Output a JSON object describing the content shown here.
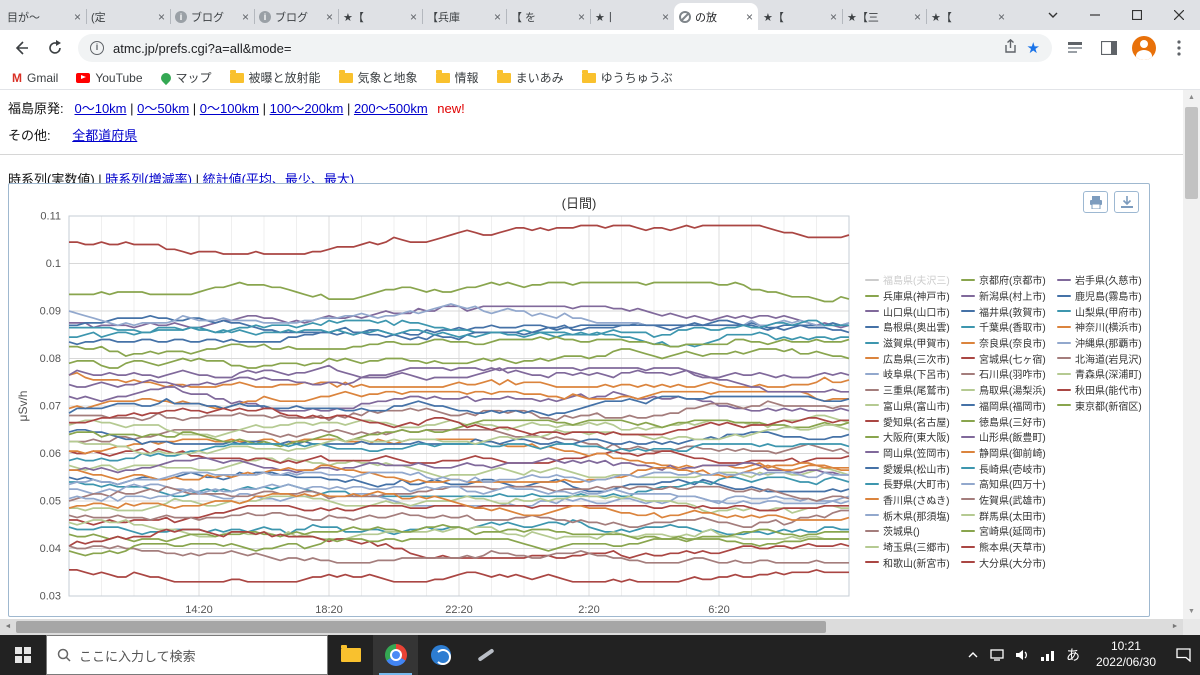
{
  "window": {
    "tabs": [
      {
        "title": "目が〜",
        "icon": "page"
      },
      {
        "title": "(定",
        "icon": "page"
      },
      {
        "title": "ブログ",
        "icon": "info"
      },
      {
        "title": "ブログ",
        "icon": "info"
      },
      {
        "title": "★【",
        "icon": "page"
      },
      {
        "title": "【兵庫",
        "icon": "page"
      },
      {
        "title": "【 を",
        "icon": "page"
      },
      {
        "title": "★丨",
        "icon": "page"
      },
      {
        "title": "の放",
        "icon": "blocked"
      },
      {
        "title": "★【",
        "icon": "page"
      },
      {
        "title": "★【三",
        "icon": "page"
      },
      {
        "title": "★【",
        "icon": "page"
      }
    ],
    "active_tab_index": 8,
    "close_glyph": "×"
  },
  "nav": {
    "url": "atmc.jp/prefs.cgi?a=all&mode="
  },
  "bookmarks": [
    {
      "label": "Gmail",
      "icon": "gmail"
    },
    {
      "label": "YouTube",
      "icon": "youtube"
    },
    {
      "label": "マップ",
      "icon": "maps"
    },
    {
      "label": "被曝と放射能",
      "icon": "folder"
    },
    {
      "label": "気象と地象",
      "icon": "folder"
    },
    {
      "label": "情報",
      "icon": "folder"
    },
    {
      "label": "まいあみ",
      "icon": "folder"
    },
    {
      "label": "ゆうちゅうぶ",
      "icon": "folder"
    }
  ],
  "page": {
    "row1_label": "福島原発:",
    "row1_links": [
      "0〜10km",
      "0〜50km",
      "0〜100km",
      "100〜200km",
      "200〜500km"
    ],
    "row1_new": "new!",
    "row2_label": "その他:",
    "row2_link": "全都道府県",
    "view_links": [
      "時系列(実数値)",
      "時系列(増減率)",
      "統計値(平均、最少、最大)"
    ],
    "view_current_index": 0
  },
  "colors": {
    "link": "#0000cc",
    "new_badge": "#e00000",
    "hidden_series": "#cccccc"
  },
  "chart_data": {
    "type": "line",
    "title": "(日間)",
    "ylabel": "μSv/h",
    "ylim": [
      0.03,
      0.11
    ],
    "yticks": [
      0.03,
      0.04,
      0.05,
      0.06,
      0.07,
      0.08,
      0.09,
      0.1,
      0.11
    ],
    "xticks": [
      "14:20",
      "18:20",
      "22:20",
      "2:20",
      "6:20"
    ],
    "xtick_point_indices": [
      16,
      32,
      48,
      64,
      80
    ],
    "points_per_series": 97,
    "x_range_hours": 24,
    "grid": true,
    "legend_position": "right",
    "legend_columns": [
      19,
      19,
      9
    ],
    "series": [
      {
        "name": "福島県(夫沢三)",
        "color": "#cccccc",
        "base": null,
        "visible": false
      },
      {
        "name": "兵庫県(神戸市)",
        "color": "#89A54E",
        "base": 0.093,
        "visible": true
      },
      {
        "name": "山口県(山口市)",
        "color": "#80699B",
        "base": 0.088,
        "visible": true
      },
      {
        "name": "島根県(奥出雲)",
        "color": "#4572A7",
        "base": 0.087,
        "visible": true
      },
      {
        "name": "滋賀県(甲賀市)",
        "color": "#3D96AE",
        "base": 0.085,
        "visible": true
      },
      {
        "name": "広島県(三次市)",
        "color": "#DB843D",
        "base": 0.077,
        "visible": true
      },
      {
        "name": "岐阜県(下呂市)",
        "color": "#92A8CD",
        "base": 0.09,
        "visible": true
      },
      {
        "name": "三重県(尾鷲市)",
        "color": "#A47D7C",
        "base": 0.062,
        "visible": true
      },
      {
        "name": "富山県(富山市)",
        "color": "#B5CA92",
        "base": 0.058,
        "visible": true
      },
      {
        "name": "愛知県(名古屋)",
        "color": "#AA4643",
        "base": 0.061,
        "visible": true
      },
      {
        "name": "大阪府(東大阪)",
        "color": "#89A54E",
        "base": 0.082,
        "visible": true
      },
      {
        "name": "岡山県(笠岡市)",
        "color": "#80699B",
        "base": 0.075,
        "visible": true
      },
      {
        "name": "愛媛県(松山市)",
        "color": "#4572A7",
        "base": 0.055,
        "visible": true
      },
      {
        "name": "長野県(大町市)",
        "color": "#3D96AE",
        "base": 0.054,
        "visible": true
      },
      {
        "name": "香川県(さぬき)",
        "color": "#DB843D",
        "base": 0.06,
        "visible": true
      },
      {
        "name": "栃木県(那須塩)",
        "color": "#92A8CD",
        "base": 0.052,
        "visible": true
      },
      {
        "name": "茨城県()",
        "color": "#A47D7C",
        "base": 0.05,
        "visible": true
      },
      {
        "name": "埼玉県(三郷市)",
        "color": "#B5CA92",
        "base": 0.048,
        "visible": true
      },
      {
        "name": "和歌山(新宮市)",
        "color": "#AA4643",
        "base": 0.046,
        "visible": true
      },
      {
        "name": "京都府(京都市)",
        "color": "#89A54E",
        "base": 0.079,
        "visible": true
      },
      {
        "name": "新潟県(村上市)",
        "color": "#80699B",
        "base": 0.072,
        "visible": true
      },
      {
        "name": "福井県(敦賀市)",
        "color": "#4572A7",
        "base": 0.084,
        "visible": true
      },
      {
        "name": "千葉県(香取市)",
        "color": "#3D96AE",
        "base": 0.044,
        "visible": true
      },
      {
        "name": "奈良県(奈良市)",
        "color": "#DB843D",
        "base": 0.07,
        "visible": true
      },
      {
        "name": "宮城県(七ヶ宿)",
        "color": "#AA4643",
        "base": 0.036,
        "visible": true
      },
      {
        "name": "石川県(羽咋市)",
        "color": "#A47D7C",
        "base": 0.068,
        "visible": true
      },
      {
        "name": "鳥取県(湯梨浜)",
        "color": "#B5CA92",
        "base": 0.066,
        "visible": true
      },
      {
        "name": "福岡県(福岡市)",
        "color": "#4572A7",
        "base": 0.065,
        "visible": true
      },
      {
        "name": "徳島県(三好市)",
        "color": "#89A54E",
        "base": 0.064,
        "visible": true
      },
      {
        "name": "山形県(飯豊町)",
        "color": "#80699B",
        "base": 0.056,
        "visible": true
      },
      {
        "name": "静岡県(御前崎)",
        "color": "#DB843D",
        "base": 0.057,
        "visible": true
      },
      {
        "name": "長崎県(壱岐市)",
        "color": "#3D96AE",
        "base": 0.059,
        "visible": true
      },
      {
        "name": "高知県(四万十)",
        "color": "#92A8CD",
        "base": 0.053,
        "visible": true
      },
      {
        "name": "佐賀県(武雄市)",
        "color": "#A47D7C",
        "base": 0.047,
        "visible": true
      },
      {
        "name": "群馬県(太田市)",
        "color": "#B5CA92",
        "base": 0.045,
        "visible": true
      },
      {
        "name": "宮崎県(延岡市)",
        "color": "#89A54E",
        "base": 0.043,
        "visible": true
      },
      {
        "name": "熊本県(天草市)",
        "color": "#AA4643",
        "base": 0.041,
        "visible": true
      },
      {
        "name": "大分県(大分市)",
        "color": "#AA4643",
        "base": 0.105,
        "visible": true
      },
      {
        "name": "岩手県(久慈市)",
        "color": "#80699B",
        "base": 0.076,
        "visible": true
      },
      {
        "name": "鹿児島(霧島市)",
        "color": "#4572A7",
        "base": 0.069,
        "visible": true
      },
      {
        "name": "山梨県(甲府市)",
        "color": "#3D96AE",
        "base": 0.086,
        "visible": true
      },
      {
        "name": "神奈川(横浜市)",
        "color": "#DB843D",
        "base": 0.049,
        "visible": true
      },
      {
        "name": "沖縄県(那覇市)",
        "color": "#92A8CD",
        "base": 0.051,
        "visible": true
      },
      {
        "name": "北海道(岩見沢)",
        "color": "#A47D7C",
        "base": 0.04,
        "visible": true
      },
      {
        "name": "青森県(深浦町)",
        "color": "#B5CA92",
        "base": 0.063,
        "visible": true
      },
      {
        "name": "秋田県(能代市)",
        "color": "#AA4643",
        "base": 0.067,
        "visible": true
      },
      {
        "name": "東京都(新宿区)",
        "color": "#89A54E",
        "base": 0.039,
        "visible": true
      }
    ]
  },
  "taskbar": {
    "search_placeholder": "ここに入力して検索",
    "ime": "あ",
    "time": "10:21",
    "date": "2022/06/30"
  }
}
